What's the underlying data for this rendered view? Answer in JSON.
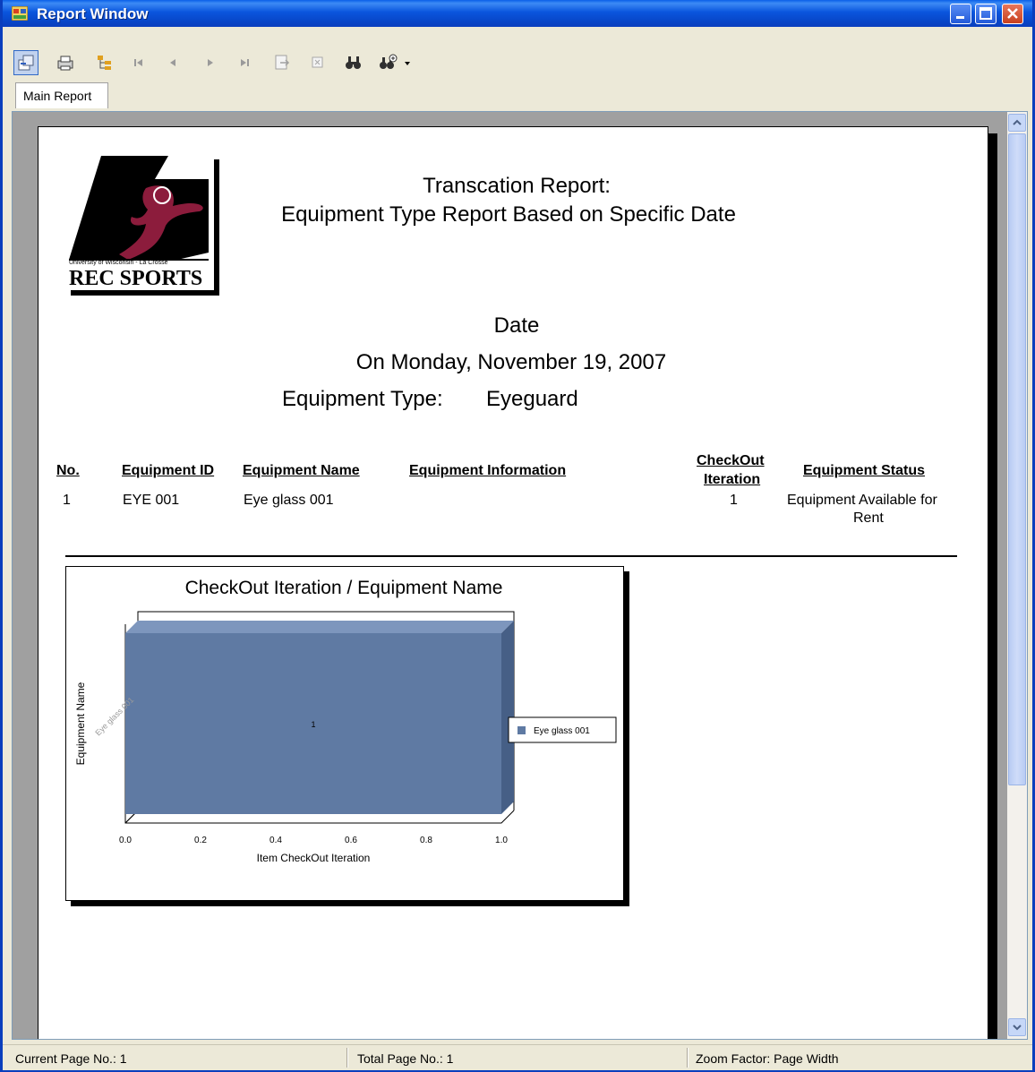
{
  "window": {
    "title": "Report Window",
    "colors": {
      "titlebar": "#0a55dd",
      "page_bg": "#ffffff",
      "viewer_bg": "#a0a0a0",
      "bar_fill": "#5f7aa3"
    }
  },
  "toolbar": {
    "icons": [
      "toggle-group-tree-icon",
      "print-icon",
      "group-tree-icon",
      "first-page-icon",
      "previous-page-icon",
      "next-page-icon",
      "last-page-icon",
      "goto-page-icon",
      "close-view-icon",
      "find-icon",
      "zoom-icon"
    ]
  },
  "tabs": [
    {
      "label": "Main Report"
    }
  ],
  "report": {
    "title_line1": "Transcation Report:",
    "title_line2": "Equipment Type Report Based on Specific Date",
    "logo_small_text": "University of Wisconsin - La Crosse",
    "logo_text": "REC SPORTS",
    "date_label": "Date",
    "date_value": "On Monday, November 19, 2007",
    "equipment_type_label": "Equipment Type:",
    "equipment_type_value": "Eyeguard",
    "columns": {
      "no": "No.",
      "equipment_id": "Equipment ID",
      "equipment_name": "Equipment Name",
      "equipment_information": "Equipment Information",
      "checkout_iteration_1": "CheckOut",
      "checkout_iteration_2": "Iteration",
      "equipment_status": "Equipment Status"
    },
    "rows": [
      {
        "no": "1",
        "equipment_id": "EYE 001",
        "equipment_name": "Eye glass 001",
        "equipment_information": "",
        "checkout_iteration": "1",
        "status_line1": "Equipment Available for",
        "status_line2": "Rent"
      }
    ]
  },
  "chart_data": {
    "type": "bar",
    "orientation": "horizontal",
    "title": "CheckOut Iteration / Equipment Name",
    "xlabel": "Item CheckOut Iteration",
    "ylabel": "Equipment Name",
    "categories": [
      "Eye glass 001"
    ],
    "series": [
      {
        "name": "Eye glass 001",
        "values": [
          1
        ]
      }
    ],
    "data_labels": [
      "1"
    ],
    "xlim": [
      0.0,
      1.0
    ],
    "xticks": [
      "0.0",
      "0.2",
      "0.4",
      "0.6",
      "0.8",
      "1.0"
    ],
    "legend_position": "right",
    "grid": false
  },
  "status": {
    "current_page": "Current Page No.: 1",
    "total_page": "Total Page No.: 1",
    "zoom": "Zoom Factor: Page Width"
  }
}
